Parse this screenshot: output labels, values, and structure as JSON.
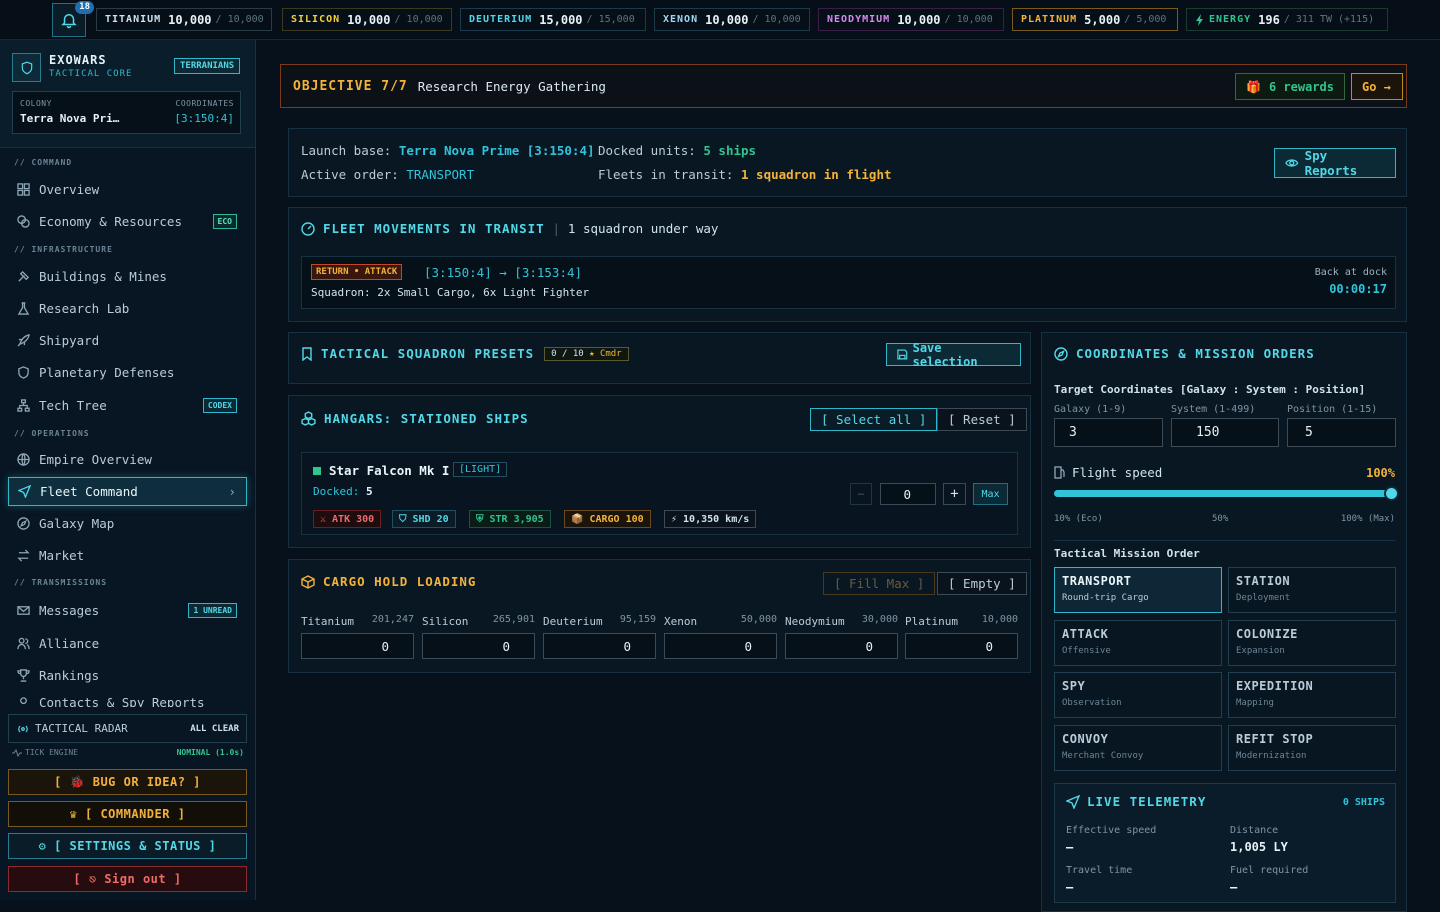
{
  "topbar": {
    "notifications": "18",
    "resources": [
      {
        "name": "TITANIUM",
        "current": "10,000",
        "max": "/ 10,000",
        "color": "#cfe3ee",
        "border": "#2a3a46"
      },
      {
        "name": "SILICON",
        "current": "10,000",
        "max": "/ 10,000",
        "color": "#f3d23a",
        "border": "#3a3a1e"
      },
      {
        "name": "DEUTERIUM",
        "current": "15,000",
        "max": "/ 15,000",
        "color": "#52d8e6",
        "border": "#1c3a4a"
      },
      {
        "name": "XENON",
        "current": "10,000",
        "max": "/ 10,000",
        "color": "#9fd8f0",
        "border": "#1c3a4a"
      },
      {
        "name": "NEODYMIUM",
        "current": "10,000",
        "max": "/ 10,000",
        "color": "#d88af0",
        "border": "#3a1e46"
      },
      {
        "name": "PLATINUM",
        "current": "5,000",
        "max": "/ 5,000",
        "color": "#f3b23a",
        "border": "#7a5a1c"
      },
      {
        "name": "ENERGY",
        "current": "196",
        "max": "/ 311 TW (+115)",
        "color": "#31c48d",
        "border": "#1c3a2e"
      }
    ]
  },
  "sidebar": {
    "brand_title": "EXOWARS",
    "brand_sub": "TACTICAL CORE",
    "faction": "TERRANIANS",
    "colony_label": "COLONY",
    "colony_name": "Terra Nova Pri…",
    "coords_label": "COORDINATES",
    "coords": "[3:150:4]",
    "sections": {
      "command": "// COMMAND",
      "infrastructure": "// INFRASTRUCTURE",
      "operations": "// OPERATIONS",
      "transmissions": "// TRANSMISSIONS"
    },
    "items": {
      "overview": "Overview",
      "economy": "Economy & Resources",
      "economy_badge": "ECO",
      "buildings": "Buildings & Mines",
      "research": "Research Lab",
      "shipyard": "Shipyard",
      "defenses": "Planetary Defenses",
      "techtree": "Tech Tree",
      "techtree_badge": "CODEX",
      "empire": "Empire Overview",
      "fleet": "Fleet Command",
      "galaxy": "Galaxy Map",
      "market": "Market",
      "messages": "Messages",
      "messages_badge": "1 UNREAD",
      "alliance": "Alliance",
      "rankings": "Rankings",
      "truncated": "Contacts & Spy Reports"
    },
    "radar_label": "TACTICAL RADAR",
    "radar_status": "ALL CLEAR",
    "tick_label": "TICK ENGINE",
    "tick_status": "NOMINAL (1.0s)",
    "bug_btn": "[ 🐞 BUG OR IDEA? ]",
    "commander_btn": "♛ [ COMMANDER ]",
    "settings_btn": "⚙ [ SETTINGS & STATUS ]",
    "signout_btn": "[ ⎋ Sign out ]"
  },
  "objective": {
    "label": "OBJECTIVE 7/7",
    "text": "Research Energy Gathering",
    "rewards": "6 rewards",
    "go": "Go →"
  },
  "info": {
    "launch_label": "Launch base:",
    "launch_value": "Terra Nova Prime [3:150:4]",
    "docked_label": "Docked units:",
    "docked_value": "5 ships",
    "order_label": "Active order:",
    "order_value": "TRANSPORT",
    "transit_label": "Fleets in transit:",
    "transit_value": "1 squadron in flight",
    "spy_btn": "Spy Reports"
  },
  "movements": {
    "title": "FLEET MOVEMENTS IN TRANSIT",
    "sep": "|",
    "subtitle": "1 squadron under way",
    "tag": "RETURN • ATTACK",
    "route": "[3:150:4] → [3:153:4]",
    "squadron": "Squadron: 2x Small Cargo, 6x Light Fighter",
    "back_label": "Back at dock",
    "back_time": "00:00:17"
  },
  "presets": {
    "title": "TACTICAL SQUADRON PRESETS",
    "count": "0 / 10",
    "star": "★",
    "rank": "Cmdr",
    "save_btn": "Save selection"
  },
  "hangars": {
    "title": "HANGARS: STATIONED SHIPS",
    "select_all": "[ Select all ]",
    "reset": "[ Reset ]",
    "ship_name": "Star Falcon Mk I",
    "ship_class": "[LIGHT]",
    "docked_label": "Docked:",
    "docked_value": "5",
    "qty": "0",
    "minus": "−",
    "plus": "+",
    "max": "Max",
    "stats": {
      "atk": "⚔ ATK 300",
      "shd": "SHD 20",
      "str": "STR 3,905",
      "cargo": "CARGO 100",
      "speed": "⚡ 10,350 km/s"
    }
  },
  "cargo": {
    "title": "CARGO HOLD LOADING",
    "fill_max": "[ Fill Max ]",
    "empty": "[ Empty ]",
    "resources": [
      {
        "name": "Titanium",
        "available": "201,247",
        "value": "0"
      },
      {
        "name": "Silicon",
        "available": "265,901",
        "value": "0"
      },
      {
        "name": "Deuterium",
        "available": "95,159",
        "value": "0"
      },
      {
        "name": "Xenon",
        "available": "50,000",
        "value": "0"
      },
      {
        "name": "Neodymium",
        "available": "30,000",
        "value": "0"
      },
      {
        "name": "Platinum",
        "available": "10,000",
        "value": "0"
      }
    ]
  },
  "orders": {
    "title": "COORDINATES & MISSION ORDERS",
    "target_label": "Target Coordinates [Galaxy : System : Position]",
    "galaxy_label": "Galaxy (1-9)",
    "galaxy": "3",
    "system_label": "System (1-499)",
    "system": "150",
    "position_label": "Position (1-15)",
    "position": "5",
    "speed_label": "Flight speed",
    "speed_value": "100%",
    "speed_fraction": 1.0,
    "speed_ticks": [
      "10% (Eco)",
      "50%",
      "100% (Max)"
    ],
    "mission_label": "Tactical Mission Order",
    "missions": [
      {
        "name": "TRANSPORT",
        "sub": "Round-trip Cargo"
      },
      {
        "name": "STATION",
        "sub": "Deployment"
      },
      {
        "name": "ATTACK",
        "sub": "Offensive"
      },
      {
        "name": "COLONIZE",
        "sub": "Expansion"
      },
      {
        "name": "SPY",
        "sub": "Observation"
      },
      {
        "name": "EXPEDITION",
        "sub": "Mapping"
      },
      {
        "name": "CONVOY",
        "sub": "Merchant Convoy"
      },
      {
        "name": "REFIT STOP",
        "sub": "Modernization"
      }
    ],
    "telemetry": {
      "title": "LIVE TELEMETRY",
      "ships": "0 SHIPS",
      "eff_label": "Effective speed",
      "eff_value": "—",
      "dist_label": "Distance",
      "dist_value": "1,005 LY",
      "time_label": "Travel time",
      "time_value": "—",
      "fuel_label": "Fuel required",
      "fuel_value": "—"
    }
  }
}
